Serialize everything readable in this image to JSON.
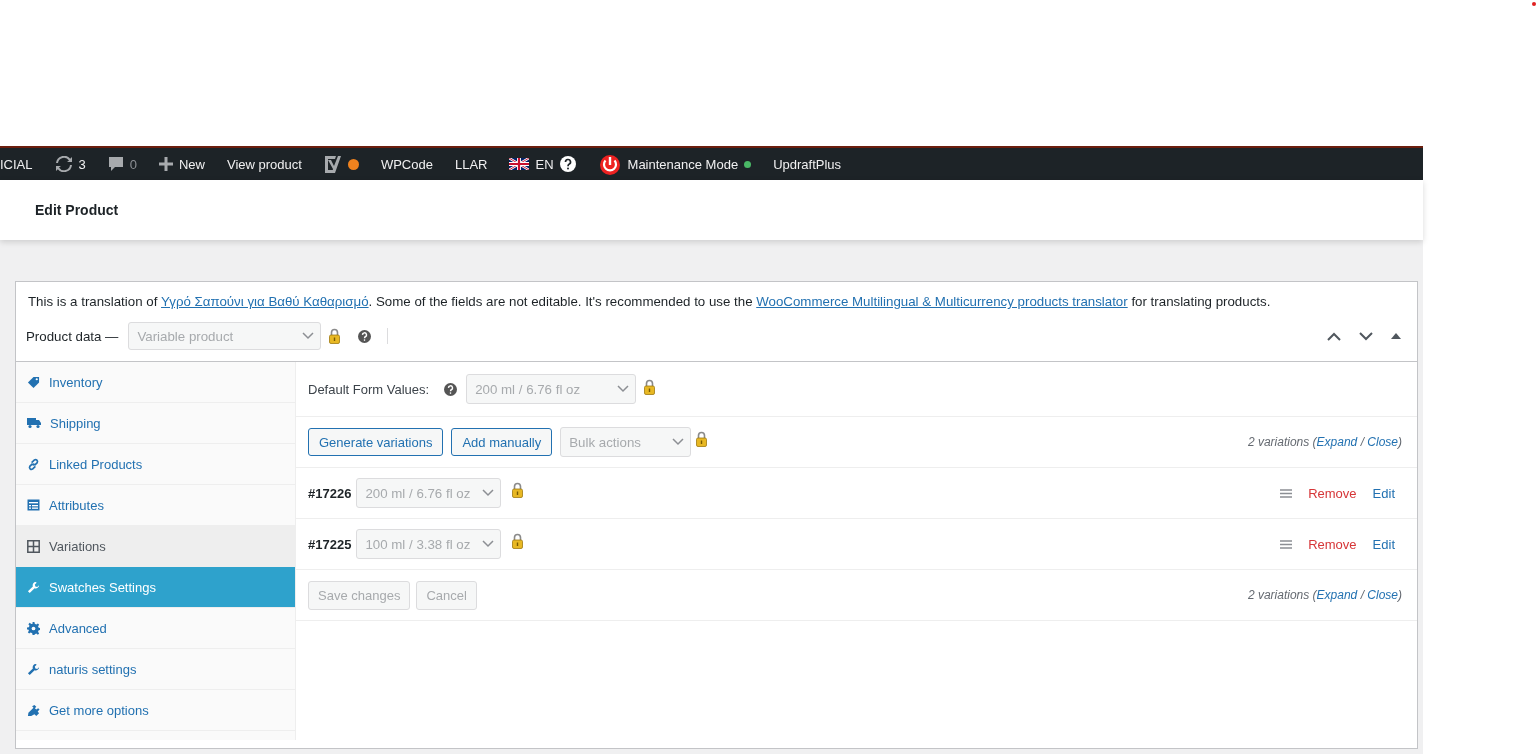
{
  "admin_bar": {
    "items": [
      {
        "kind": "text",
        "label": "ICIAL"
      },
      {
        "kind": "updates",
        "label": "3"
      },
      {
        "kind": "comments",
        "label": "0"
      },
      {
        "kind": "new",
        "label": "New"
      },
      {
        "kind": "text",
        "label": "View product"
      },
      {
        "kind": "seo",
        "color": "#f0821e"
      },
      {
        "kind": "text",
        "label": "WPCode"
      },
      {
        "kind": "text",
        "label": "LLAR"
      },
      {
        "kind": "language",
        "label": "EN"
      },
      {
        "kind": "maintenance",
        "label": "Maintenance Mode",
        "color": "#4ab866"
      },
      {
        "kind": "text",
        "label": "UpdraftPlus"
      }
    ]
  },
  "header": {
    "title": "Edit Product"
  },
  "notice": {
    "parts": [
      {
        "kind": "text",
        "text": "This is a translation of "
      },
      {
        "kind": "link",
        "text": "Υγρό Σαπούνι για Βαθύ Καθαρισμό"
      },
      {
        "kind": "text",
        "text": ". Some of the fields are not editable. It's recommended to use the "
      },
      {
        "kind": "link",
        "text": "WooCommerce Multilingual & Multicurrency products translator"
      },
      {
        "kind": "text",
        "text": " for translating products."
      }
    ]
  },
  "product_data": {
    "label": "Product data —",
    "type_value": "Variable product",
    "tabs": [
      {
        "kind": "tag",
        "label": "Inventory",
        "selected": false,
        "highlighted": false
      },
      {
        "kind": "truck",
        "label": "Shipping",
        "selected": false,
        "highlighted": false
      },
      {
        "kind": "link",
        "label": "Linked Products",
        "selected": false,
        "highlighted": false
      },
      {
        "kind": "list",
        "label": "Attributes",
        "selected": false,
        "highlighted": false
      },
      {
        "kind": "grid",
        "label": "Variations",
        "selected": true,
        "highlighted": false
      },
      {
        "kind": "wrench",
        "label": "Swatches Settings",
        "selected": false,
        "highlighted": true
      },
      {
        "kind": "gear",
        "label": "Advanced",
        "selected": false,
        "highlighted": false
      },
      {
        "kind": "wrench",
        "label": "naturis settings",
        "selected": false,
        "highlighted": false
      },
      {
        "kind": "plug",
        "label": "Get more options",
        "selected": false,
        "highlighted": false
      }
    ]
  },
  "variations": {
    "default_form": {
      "label": "Default Form Values:",
      "value": "200 ml / 6.76 fl oz"
    },
    "toolbar": {
      "buttons": [
        "Generate variations",
        "Add manually"
      ],
      "bulk_placeholder": "Bulk actions",
      "summary": [
        {
          "kind": "text",
          "text": "2 variations ("
        },
        {
          "kind": "link",
          "text": "Expand"
        },
        {
          "kind": "text",
          "text": " / "
        },
        {
          "kind": "link",
          "text": "Close"
        },
        {
          "kind": "text",
          "text": ")"
        }
      ]
    },
    "rows": [
      {
        "id": "#17226",
        "value": "200 ml / 6.76 fl oz",
        "remove": "Remove",
        "edit": "Edit"
      },
      {
        "id": "#17225",
        "value": "100 ml / 3.38 fl oz",
        "remove": "Remove",
        "edit": "Edit"
      }
    ],
    "footer": {
      "buttons": [
        {
          "label": "Save changes",
          "disabled": true
        },
        {
          "label": "Cancel",
          "disabled": true
        }
      ],
      "summary": [
        {
          "kind": "text",
          "text": "2 variations ("
        },
        {
          "kind": "link",
          "text": "Expand"
        },
        {
          "kind": "text",
          "text": " / "
        },
        {
          "kind": "link",
          "text": "Close"
        },
        {
          "kind": "text",
          "text": ")"
        }
      ]
    }
  }
}
